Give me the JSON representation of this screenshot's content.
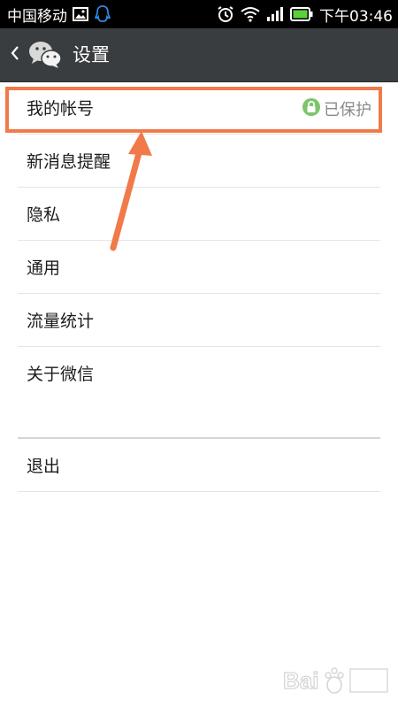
{
  "status_bar": {
    "carrier": "中国移动",
    "time": "下午03:46"
  },
  "header": {
    "title": "设置"
  },
  "menu": {
    "items": [
      {
        "label": "我的帐号",
        "status": "已保护"
      },
      {
        "label": "新消息提醒"
      },
      {
        "label": "隐私"
      },
      {
        "label": "通用"
      },
      {
        "label": "流量统计"
      },
      {
        "label": "关于微信"
      }
    ],
    "logout_label": "退出"
  },
  "icons": {
    "status_bar": [
      "image-icon",
      "qq-icon",
      "alarm-icon",
      "wifi-icon",
      "signal-icon",
      "battery-icon"
    ],
    "header": [
      "back-chevron-icon",
      "wechat-logo-icon"
    ],
    "menu": [
      "lock-icon"
    ]
  },
  "colors": {
    "header_bg": "#3a3d40",
    "annotation": "#f07a4a",
    "battery": "#5bd13c",
    "lock": "#7ec46b"
  }
}
